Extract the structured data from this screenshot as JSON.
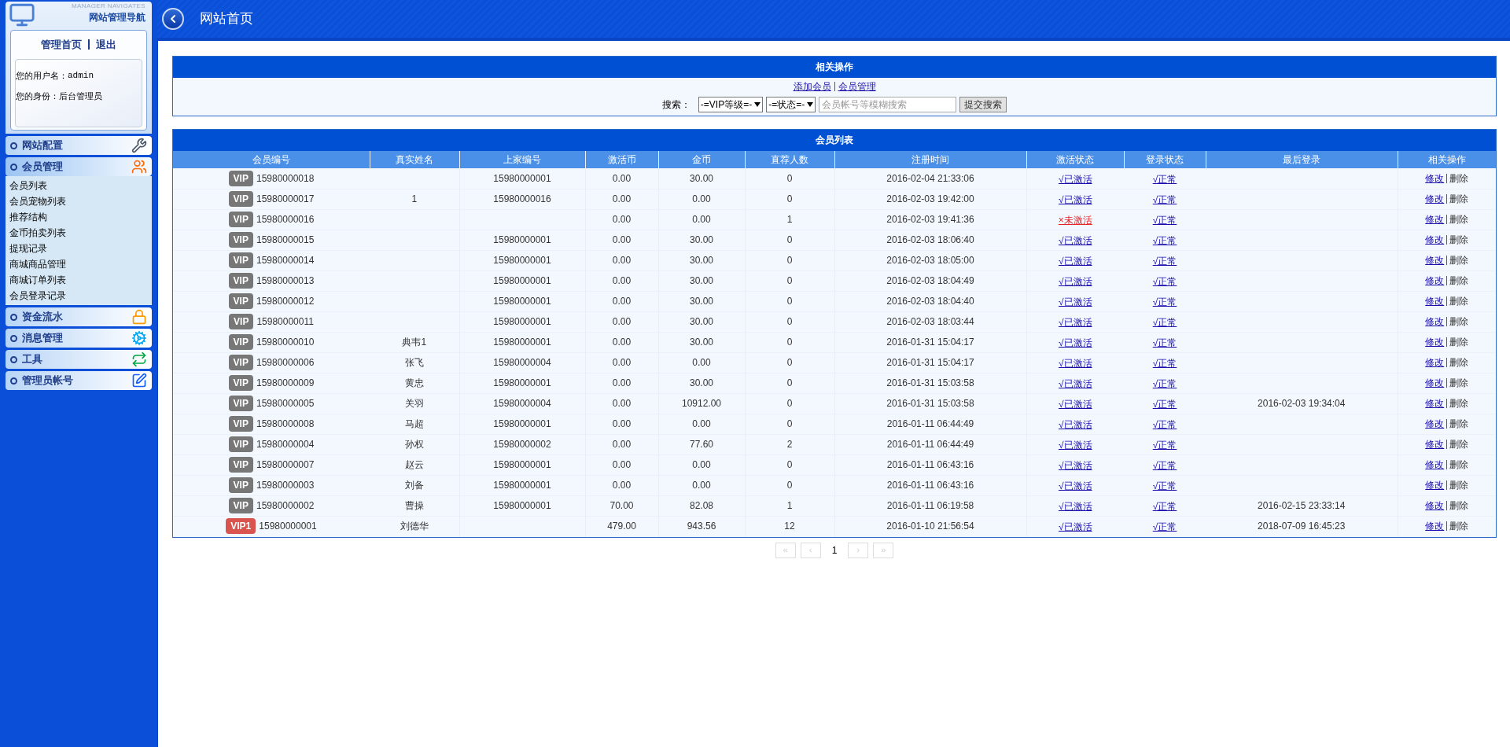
{
  "sidebar": {
    "logo_caption": "MANAGER NAVIGATES",
    "logo_title": "网站管理导航",
    "links": [
      "管理首页",
      "退出"
    ],
    "user_lines": [
      {
        "label": "您的用户名：",
        "value": "admin"
      },
      {
        "label": "您的身份：",
        "value": "后台管理员"
      }
    ],
    "sections": [
      {
        "title": "网站配置",
        "expanded": false
      },
      {
        "title": "会员管理",
        "expanded": true,
        "items": [
          "会员列表",
          "会员宠物列表",
          "推荐结构",
          "金币拍卖列表",
          "提现记录",
          "商城商品管理",
          "商城订单列表",
          "会员登录记录"
        ]
      },
      {
        "title": "资金流水",
        "expanded": false
      },
      {
        "title": "消息管理",
        "expanded": false
      },
      {
        "title": "工具",
        "expanded": false
      },
      {
        "title": "管理员帐号",
        "expanded": false
      }
    ]
  },
  "header": {
    "title": "网站首页"
  },
  "operations": {
    "title": "相关操作",
    "links": [
      "添加会员",
      "会员管理"
    ],
    "search_label": "搜索：",
    "selects": [
      "-=VIP等级=-",
      "-=状态=-"
    ],
    "placeholder": "会员帐号等模糊搜索",
    "button": "提交搜索"
  },
  "members": {
    "title": "会员列表",
    "columns": [
      "会员编号",
      "真实姓名",
      "上家编号",
      "激活币",
      "金币",
      "直荐人数",
      "注册时间",
      "激活状态",
      "登录状态",
      "最后登录",
      "相关操作"
    ],
    "rows": [
      {
        "badge": {
          "text": "VIP",
          "kind": "basic"
        },
        "id": "15980000018",
        "referrer": "15980000001",
        "activation_coins": "0.00",
        "coins": "30.00",
        "referrals": "0",
        "registered": "2016-02-04 21:33:06",
        "activation": {
          "text": "√已激活",
          "activated": true
        },
        "login_status": "√正常",
        "actions": [
          "修改",
          "删除"
        ]
      },
      {
        "badge": {
          "text": "VIP",
          "kind": "basic"
        },
        "id": "15980000017",
        "name": "1",
        "referrer": "15980000016",
        "activation_coins": "0.00",
        "coins": "0.00",
        "referrals": "0",
        "registered": "2016-02-03 19:42:00",
        "activation": {
          "text": "√已激活",
          "activated": true
        },
        "login_status": "√正常",
        "actions": [
          "修改",
          "删除"
        ]
      },
      {
        "badge": {
          "text": "VIP",
          "kind": "basic"
        },
        "id": "15980000016",
        "activation_coins": "0.00",
        "coins": "0.00",
        "referrals": "1",
        "registered": "2016-02-03 19:41:36",
        "activation": {
          "text": "×未激活",
          "activated": false
        },
        "login_status": "√正常",
        "actions": [
          "修改",
          "删除"
        ]
      },
      {
        "badge": {
          "text": "VIP",
          "kind": "basic"
        },
        "id": "15980000015",
        "referrer": "15980000001",
        "activation_coins": "0.00",
        "coins": "30.00",
        "referrals": "0",
        "registered": "2016-02-03 18:06:40",
        "activation": {
          "text": "√已激活",
          "activated": true
        },
        "login_status": "√正常",
        "actions": [
          "修改",
          "删除"
        ]
      },
      {
        "badge": {
          "text": "VIP",
          "kind": "basic"
        },
        "id": "15980000014",
        "referrer": "15980000001",
        "activation_coins": "0.00",
        "coins": "30.00",
        "referrals": "0",
        "registered": "2016-02-03 18:05:00",
        "activation": {
          "text": "√已激活",
          "activated": true
        },
        "login_status": "√正常",
        "actions": [
          "修改",
          "删除"
        ]
      },
      {
        "badge": {
          "text": "VIP",
          "kind": "basic"
        },
        "id": "15980000013",
        "referrer": "15980000001",
        "activation_coins": "0.00",
        "coins": "30.00",
        "referrals": "0",
        "registered": "2016-02-03 18:04:49",
        "activation": {
          "text": "√已激活",
          "activated": true
        },
        "login_status": "√正常",
        "actions": [
          "修改",
          "删除"
        ]
      },
      {
        "badge": {
          "text": "VIP",
          "kind": "basic"
        },
        "id": "15980000012",
        "referrer": "15980000001",
        "activation_coins": "0.00",
        "coins": "30.00",
        "referrals": "0",
        "registered": "2016-02-03 18:04:40",
        "activation": {
          "text": "√已激活",
          "activated": true
        },
        "login_status": "√正常",
        "actions": [
          "修改",
          "删除"
        ]
      },
      {
        "badge": {
          "text": "VIP",
          "kind": "basic"
        },
        "id": "15980000011",
        "referrer": "15980000001",
        "activation_coins": "0.00",
        "coins": "30.00",
        "referrals": "0",
        "registered": "2016-02-03 18:03:44",
        "activation": {
          "text": "√已激活",
          "activated": true
        },
        "login_status": "√正常",
        "actions": [
          "修改",
          "删除"
        ]
      },
      {
        "badge": {
          "text": "VIP",
          "kind": "basic"
        },
        "id": "15980000010",
        "name": "典韦1",
        "referrer": "15980000001",
        "activation_coins": "0.00",
        "coins": "30.00",
        "referrals": "0",
        "registered": "2016-01-31 15:04:17",
        "activation": {
          "text": "√已激活",
          "activated": true
        },
        "login_status": "√正常",
        "actions": [
          "修改",
          "删除"
        ]
      },
      {
        "badge": {
          "text": "VIP",
          "kind": "basic"
        },
        "id": "15980000006",
        "name": "张飞",
        "referrer": "15980000004",
        "activation_coins": "0.00",
        "coins": "0.00",
        "referrals": "0",
        "registered": "2016-01-31 15:04:17",
        "activation": {
          "text": "√已激活",
          "activated": true
        },
        "login_status": "√正常",
        "actions": [
          "修改",
          "删除"
        ]
      },
      {
        "badge": {
          "text": "VIP",
          "kind": "basic"
        },
        "id": "15980000009",
        "name": "黄忠",
        "referrer": "15980000001",
        "activation_coins": "0.00",
        "coins": "30.00",
        "referrals": "0",
        "registered": "2016-01-31 15:03:58",
        "activation": {
          "text": "√已激活",
          "activated": true
        },
        "login_status": "√正常",
        "actions": [
          "修改",
          "删除"
        ]
      },
      {
        "badge": {
          "text": "VIP",
          "kind": "basic"
        },
        "id": "15980000005",
        "name": "关羽",
        "referrer": "15980000004",
        "activation_coins": "0.00",
        "coins": "10912.00",
        "referrals": "0",
        "registered": "2016-01-31 15:03:58",
        "activation": {
          "text": "√已激活",
          "activated": true
        },
        "login_status": "√正常",
        "last_login": "2016-02-03 19:34:04",
        "actions": [
          "修改",
          "删除"
        ]
      },
      {
        "badge": {
          "text": "VIP",
          "kind": "basic"
        },
        "id": "15980000008",
        "name": "马超",
        "referrer": "15980000001",
        "activation_coins": "0.00",
        "coins": "0.00",
        "referrals": "0",
        "registered": "2016-01-11 06:44:49",
        "activation": {
          "text": "√已激活",
          "activated": true
        },
        "login_status": "√正常",
        "actions": [
          "修改",
          "删除"
        ]
      },
      {
        "badge": {
          "text": "VIP",
          "kind": "basic"
        },
        "id": "15980000004",
        "name": "孙权",
        "referrer": "15980000002",
        "activation_coins": "0.00",
        "coins": "77.60",
        "referrals": "2",
        "registered": "2016-01-11 06:44:49",
        "activation": {
          "text": "√已激活",
          "activated": true
        },
        "login_status": "√正常",
        "actions": [
          "修改",
          "删除"
        ]
      },
      {
        "badge": {
          "text": "VIP",
          "kind": "basic"
        },
        "id": "15980000007",
        "name": "赵云",
        "referrer": "15980000001",
        "activation_coins": "0.00",
        "coins": "0.00",
        "referrals": "0",
        "registered": "2016-01-11 06:43:16",
        "activation": {
          "text": "√已激活",
          "activated": true
        },
        "login_status": "√正常",
        "actions": [
          "修改",
          "删除"
        ]
      },
      {
        "badge": {
          "text": "VIP",
          "kind": "basic"
        },
        "id": "15980000003",
        "name": "刘备",
        "referrer": "15980000001",
        "activation_coins": "0.00",
        "coins": "0.00",
        "referrals": "0",
        "registered": "2016-01-11 06:43:16",
        "activation": {
          "text": "√已激活",
          "activated": true
        },
        "login_status": "√正常",
        "actions": [
          "修改",
          "删除"
        ]
      },
      {
        "badge": {
          "text": "VIP",
          "kind": "basic"
        },
        "id": "15980000002",
        "name": "曹操",
        "referrer": "15980000001",
        "activation_coins": "70.00",
        "coins": "82.08",
        "referrals": "1",
        "registered": "2016-01-11 06:19:58",
        "activation": {
          "text": "√已激活",
          "activated": true
        },
        "login_status": "√正常",
        "last_login": "2016-02-15 23:33:14",
        "actions": [
          "修改",
          "删除"
        ]
      },
      {
        "badge": {
          "text": "VIP1",
          "kind": "premium"
        },
        "id": "15980000001",
        "name": "刘德华",
        "activation_coins": "479.00",
        "coins": "943.56",
        "referrals": "12",
        "registered": "2016-01-10 21:56:54",
        "activation": {
          "text": "√已激活",
          "activated": true
        },
        "login_status": "√正常",
        "last_login": "2018-07-09 16:45:23",
        "actions": [
          "修改",
          "删除"
        ]
      }
    ]
  },
  "pagination": [
    {
      "label": "«",
      "selected": false,
      "disabled": true
    },
    {
      "label": "‹",
      "selected": false,
      "disabled": true
    },
    {
      "label": "1",
      "selected": true,
      "disabled": false
    },
    {
      "label": "›",
      "selected": false,
      "disabled": true
    },
    {
      "label": "»",
      "selected": false,
      "disabled": true
    }
  ]
}
